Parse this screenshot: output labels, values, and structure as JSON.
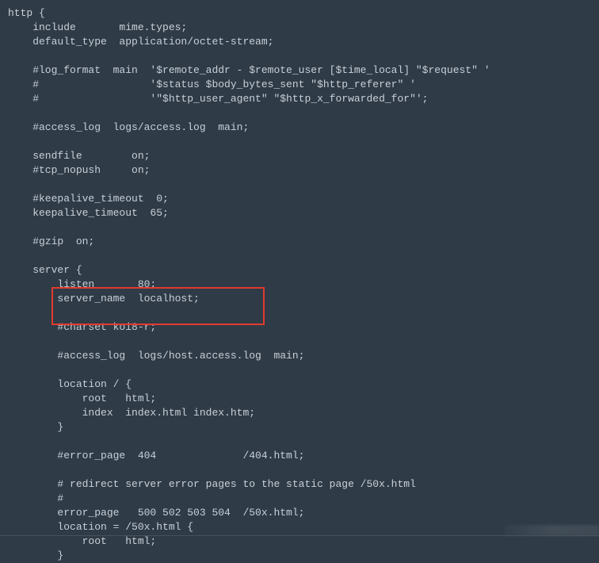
{
  "highlight": {
    "lines": [
      20,
      21
    ]
  },
  "code": {
    "lines": [
      "http {",
      "    include       mime.types;",
      "    default_type  application/octet-stream;",
      "",
      "    #log_format  main  '$remote_addr - $remote_user [$time_local] \"$request\" '",
      "    #                  '$status $body_bytes_sent \"$http_referer\" '",
      "    #                  '\"$http_user_agent\" \"$http_x_forwarded_for\"';",
      "",
      "    #access_log  logs/access.log  main;",
      "",
      "    sendfile        on;",
      "    #tcp_nopush     on;",
      "",
      "    #keepalive_timeout  0;",
      "    keepalive_timeout  65;",
      "",
      "    #gzip  on;",
      "",
      "    server {",
      "        listen       80;",
      "        server_name  localhost;",
      "",
      "        #charset koi8-r;",
      "",
      "        #access_log  logs/host.access.log  main;",
      "",
      "        location / {",
      "            root   html;",
      "            index  index.html index.htm;",
      "        }",
      "",
      "        #error_page  404              /404.html;",
      "",
      "        # redirect server error pages to the static page /50x.html",
      "        #",
      "        error_page   500 502 503 504  /50x.html;",
      "        location = /50x.html {",
      "            root   html;",
      "        }"
    ]
  }
}
